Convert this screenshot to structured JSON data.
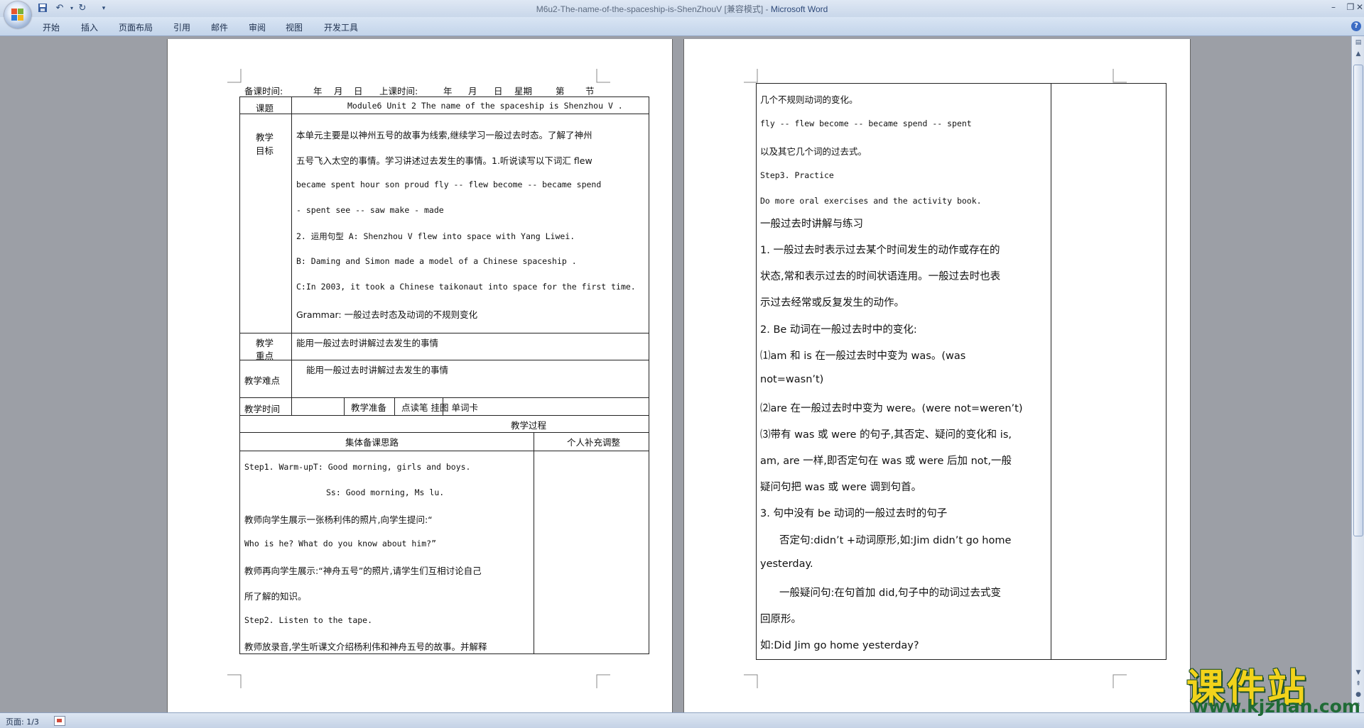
{
  "window": {
    "doc_name": "M6u2-The-name-of-the-spaceship-is-ShenZhouV [兼容模式] - ",
    "app_name": "Microsoft Word"
  },
  "ribbon": {
    "tabs": [
      "开始",
      "插入",
      "页面布局",
      "引用",
      "邮件",
      "审阅",
      "视图",
      "开发工具"
    ]
  },
  "status": {
    "page": "页面: 1/3"
  },
  "page1": {
    "header": {
      "prep": "备课时间:",
      "year1": "年",
      "month1": "月",
      "day1": "日",
      "class": "上课时间:",
      "year2": "年",
      "month2": "月",
      "day2": "日",
      "week": "星期",
      "period1": "第",
      "period2": "节"
    },
    "topic_label": "课题",
    "topic_value": "Module6 Unit 2  The name of the spaceship is Shenzhou V .",
    "goal_label_1": "教学",
    "goal_label_2": "目标",
    "goals": [
      "本单元主要是以神州五号的故事为线索,继续学习一般过去时态。了解了神州",
      "五号飞入太空的事情。学习讲述过去发生的事情。1.听说读写以下词汇 flew",
      "became  spent  hour  son  proud fly -- flew   become -- became  spend",
      "- spent see -- saw   make - made",
      "2.  运用句型 A: Shenzhou V flew into space with Yang Liwei.",
      "B: Daming and Simon made a model of a Chinese spaceship .",
      "C:In 2003, it took a Chinese taikonaut into space for the first time.",
      "Grammar: 一般过去时态及动词的不规则变化"
    ],
    "focus_label_1": "教学",
    "focus_label_2": "重点",
    "focus_value": "能用一般过去时讲解过去发生的事情",
    "difficulty_label": "教学难点",
    "difficulty_value": "能用一般过去时讲解过去发生的事情",
    "time_label": "教学时间",
    "prep_label": "教学准备",
    "prep_value": "点读笔  挂图  单词卡",
    "process_label": "教学过程",
    "col_plan": "集体备课思路",
    "col_personal": "个人补充调整",
    "process_lines": [
      "Step1.   Warm-upT: Good morning, girls and boys.",
      "Ss: Good morning, Ms lu.",
      "教师向学生展示一张杨利伟的照片,向学生提问:“",
      "Who is he? What do you know about him?”",
      "教师再向学生展示:“神舟五号”的照片,请学生们互相讨论自己",
      "所了解的知识。",
      "Step2. Listen to the tape.",
      "教师放录音,学生听课文介绍杨利伟和神舟五号的故事。并解释"
    ]
  },
  "page2": {
    "lines": [
      "几个不规则动词的变化。",
      "fly -- flew   become -- became   spend -- spent",
      "以及其它几个词的过去式。",
      "Step3. Practice",
      "Do more oral exercises and the activity book.",
      "一般过去时讲解与练习",
      "1. 一般过去时表示过去某个时间发生的动作或存在的",
      "状态,常和表示过去的时间状语连用。一般过去时也表",
      "示过去经常或反复发生的动作。",
      "2. Be 动词在一般过去时中的变化:",
      "⑴am 和 is 在一般过去时中变为 was。(was",
      "not=wasn’t)",
      "⑵are 在一般过去时中变为 were。(were not=weren’t)",
      "⑶带有 was 或 were 的句子,其否定、疑问的变化和 is,",
      "am, are 一样,即否定句在 was 或 were 后加 not,一般",
      "疑问句把 was 或 were 调到句首。",
      "3. 句中没有 be 动词的一般过去时的句子",
      "否定句:didn’t +动词原形,如:Jim didn’t go home",
      "yesterday.",
      "一般疑问句:在句首加 did,句子中的动词过去式变",
      "回原形。",
      "如:Did Jim go home yesterday?"
    ]
  },
  "watermark": {
    "title": "课件站",
    "url": "www.kjzhan.com"
  },
  "colors": {
    "workspace": "#9c9fa6",
    "ribbon": "#c3d4ea",
    "watermark_yellow": "#f2d31b",
    "watermark_green": "#1f6b35",
    "title_app": "#2f4a7a"
  }
}
